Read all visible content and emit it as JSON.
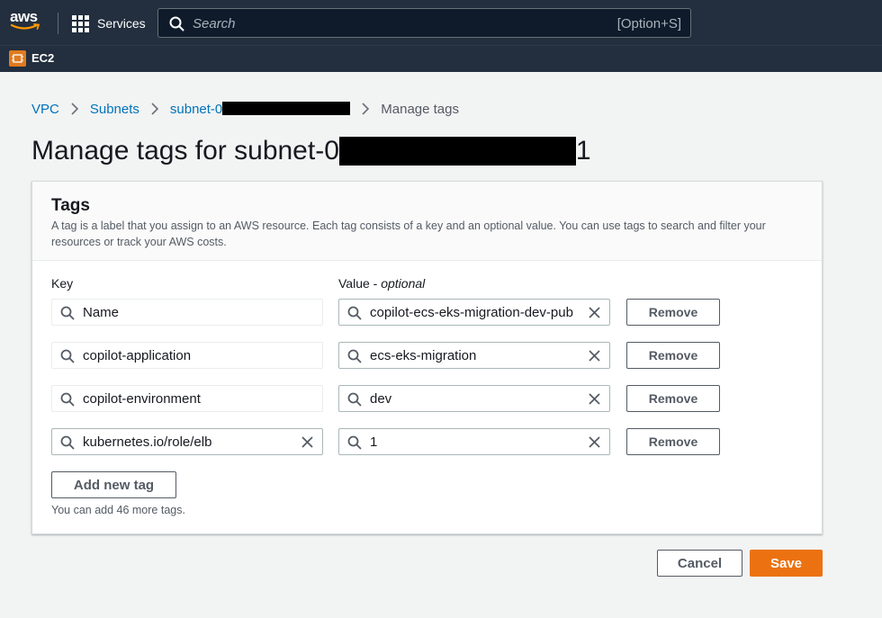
{
  "nav": {
    "logo_text": "aws",
    "services_label": "Services",
    "search_placeholder": "Search",
    "search_shortcut": "[Option+S]",
    "service_name": "EC2"
  },
  "breadcrumb": {
    "items": [
      {
        "label": "VPC"
      },
      {
        "label": "Subnets"
      },
      {
        "label": "subnet-0"
      }
    ],
    "current": "Manage tags"
  },
  "page": {
    "title_prefix": "Manage tags for subnet-0",
    "title_suffix": "1"
  },
  "tags_panel": {
    "title": "Tags",
    "description": "A tag is a label that you assign to an AWS resource. Each tag consists of a key and an optional value. You can use tags to search and filter your resources or track your AWS costs.",
    "key_label": "Key",
    "value_label": "Value - ",
    "value_optional": "optional",
    "remove_label": "Remove",
    "rows": [
      {
        "key": "Name",
        "value": "copilot-ecs-eks-migration-dev-pub"
      },
      {
        "key": "copilot-application",
        "value": "ecs-eks-migration"
      },
      {
        "key": "copilot-environment",
        "value": "dev"
      },
      {
        "key": "kubernetes.io/role/elb",
        "value": "1"
      }
    ],
    "add_label": "Add new tag",
    "hint": "You can add 46 more tags."
  },
  "actions": {
    "cancel_label": "Cancel",
    "save_label": "Save"
  },
  "colors": {
    "nav_bg": "#232f3e",
    "link": "#0073bb",
    "primary": "#ec7211"
  }
}
